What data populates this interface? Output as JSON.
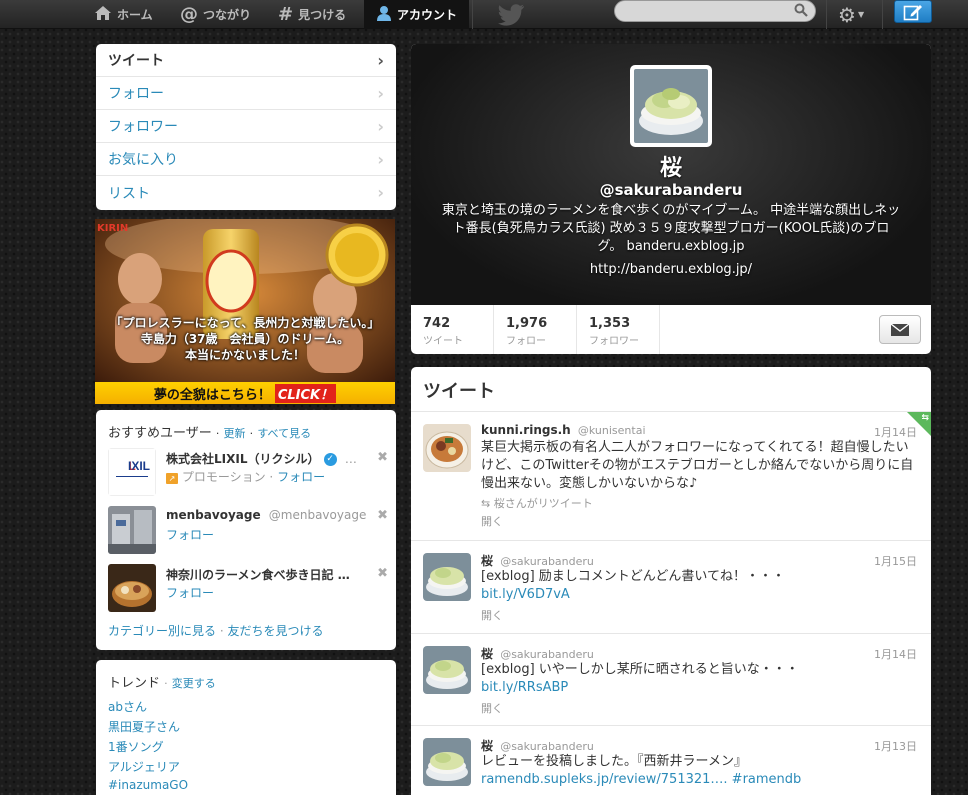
{
  "topnav": {
    "home": "ホーム",
    "connect": "つながり",
    "discover": "見つける",
    "account": "アカウント",
    "search_placeholder": ""
  },
  "sidebar": {
    "items": [
      {
        "label": "ツイート"
      },
      {
        "label": "フォロー"
      },
      {
        "label": "フォロワー"
      },
      {
        "label": "お気に入り"
      },
      {
        "label": "リスト"
      }
    ]
  },
  "ad": {
    "brand": "KIRIN",
    "line1": "「プロレスラーになって、長州力と対戦したい。」",
    "line2": "寺島力（37歳　会社員）のドリーム。",
    "line3": "本当にかないました！",
    "bar": "夢の全貌はこちら！",
    "click": "CLICK！"
  },
  "recommend": {
    "title": "おすすめユーザー",
    "refresh": "更新",
    "see_all": "すべて見る",
    "sep": "·",
    "users": [
      {
        "name": "株式会社LIXIL（リクシル）",
        "handle": "…",
        "sub_promo": "プロモーション",
        "sub_follow": "フォロー"
      },
      {
        "name": "menbavoyage",
        "handle": "@menbavoyage",
        "sub_follow": "フォロー"
      },
      {
        "name": "神奈川のラーメン食べ歩き日記 …",
        "handle": "",
        "sub_follow": "フォロー"
      }
    ],
    "browse_categories": "カテゴリー別に見る",
    "find_friends": "友だちを見つける"
  },
  "trends": {
    "title": "トレンド",
    "change": "変更する",
    "items": [
      "abさん",
      "黒田夏子さん",
      "1番ソング",
      "アルジェリア",
      "#inazumaGO"
    ]
  },
  "profile": {
    "name": "桜",
    "handle": "@sakurabanderu",
    "bio": "東京と埼玉の境のラーメンを食べ歩くのがマイブーム。 中途半端な顔出しネット番長(負死鳥カラス氏談) 改め３５９度攻撃型ブロガー(KOOL氏談)のブログ。 banderu.exblog.jp",
    "url": "http://banderu.exblog.jp/",
    "stats": [
      {
        "num": "742",
        "label": "ツイート"
      },
      {
        "num": "1,976",
        "label": "フォロー"
      },
      {
        "num": "1,353",
        "label": "フォロワー"
      }
    ]
  },
  "tweets": {
    "title": "ツイート",
    "items": [
      {
        "name": "kunni.rings.h",
        "handle": "@kunisentai",
        "date": "1月14日",
        "text": "某巨大掲示板の有名人二人がフォロワーになってくれてる！超自慢したいけど、このTwitterその物がエステブロガーとしか絡んでないから周りに自慢出来ない。変態しかいないからな♪",
        "retweet": "桜さんがリツイート",
        "open": "開く"
      },
      {
        "name": "桜",
        "handle": "@sakurabanderu",
        "date": "1月15日",
        "text": "[exblog] 励ましコメントどんどん書いてね！・・・",
        "link": "bit.ly/V6D7vA",
        "open": "開く"
      },
      {
        "name": "桜",
        "handle": "@sakurabanderu",
        "date": "1月14日",
        "text": "[exblog] いやーしかし某所に晒されると旨いな・・・",
        "link": "bit.ly/RRsABP",
        "open": "開く"
      },
      {
        "name": "桜",
        "handle": "@sakurabanderu",
        "date": "1月13日",
        "text": "レビューを投稿しました。『西新井ラーメン』",
        "link": "ramendb.supleks.jp/review/751321….",
        "hashtag": "#ramendb",
        "open": "開く"
      }
    ]
  },
  "colors": {
    "accent": "#2a8ab8",
    "compose": "#1f7dc4",
    "retweet": "#5cb85c"
  }
}
